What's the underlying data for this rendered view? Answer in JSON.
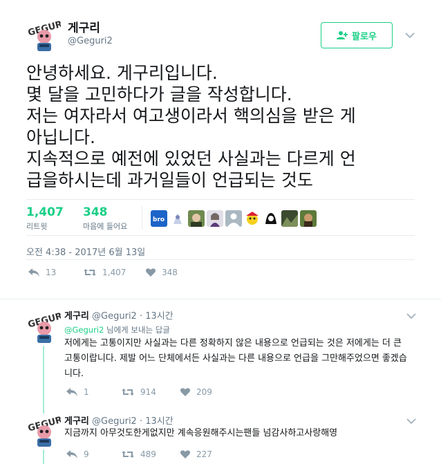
{
  "main": {
    "name": "게구리",
    "handle": "@Geguri2",
    "follow_label": "팔로우",
    "text_lines": [
      "안녕하세요. 게구리입니다.",
      "몇 달을 고민하다가 글을 작성합니다.",
      "저는 여자라서 여고생이라서 핵의심을 받은 게",
      "아닙니다.",
      "지속적으로 예전에 있었던 사실과는 다르게 언",
      "급을하시는데 과거일들이 언급되는 것도"
    ],
    "retweets_num": "1,407",
    "retweets_label": "리트윗",
    "likes_num": "348",
    "likes_label": "마음에 들어요",
    "timestamp": "오전 4:38 - 2017년 6월 13일",
    "actions": {
      "reply": "13",
      "retweet": "1,407",
      "like": "348"
    }
  },
  "replies": [
    {
      "name": "게구리",
      "handle": "@Geguri2",
      "sep": "·",
      "time": "13시간",
      "context_handle": "@Geguri2",
      "context_text": " 님에게 보내는 답글",
      "text": "저에게는 고통이지만 사실과는 다른 정확하지 않은 내용으로 언급되는 것은 저에게는 더 큰 고통이랍니다. 제발 어느 단체에서든 사실과는 다른 내용으로 언급을 그만해주었으면 좋겠습니다.",
      "actions": {
        "reply": "1",
        "retweet": "914",
        "like": "209"
      }
    },
    {
      "name": "게구리",
      "handle": "@Geguri2",
      "sep": "·",
      "time": "13시간",
      "text": "지금까지 아무것도한게없지만 계속응원해주시는팬들 넘감사하고사랑해영",
      "actions": {
        "reply": "9",
        "retweet": "489",
        "like": "227"
      }
    }
  ],
  "colors": {
    "accent": "#19cf86",
    "muted": "#657786",
    "icon": "#8899a6",
    "thread_line": "#a3ecd0"
  },
  "icons": {
    "follow": "add-user-icon",
    "more": "chevron-down-icon",
    "reply": "reply-icon",
    "retweet": "retweet-icon",
    "like": "heart-icon"
  }
}
